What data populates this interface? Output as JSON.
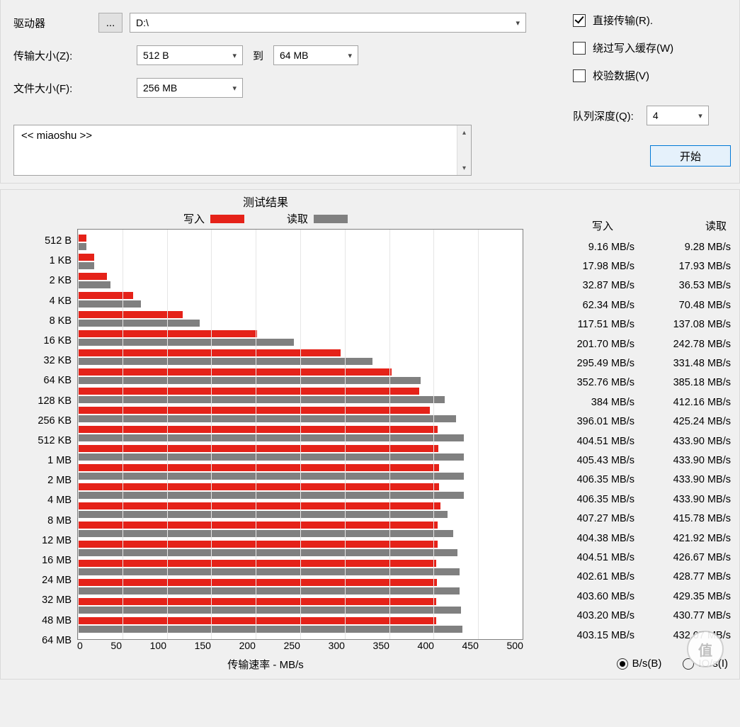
{
  "labels": {
    "drive": "驱动器",
    "transfer_size": "传输大小(Z):",
    "to": "到",
    "file_size": "文件大小(F):",
    "direct_transfer": "直接传输(R).",
    "bypass_cache": "绕过写入缓存(W)",
    "verify": "校验数据(V)",
    "queue_depth": "队列深度(Q):",
    "start_button": "开始",
    "description_placeholder": "<< miaoshu >>",
    "results_title": "测试结果",
    "legend_write": "写入",
    "legend_read": "读取",
    "xlabel": "传输速率 - MB/s",
    "values_write": "写入",
    "values_read": "读取",
    "unit_bps": "B/s(B)",
    "unit_ios": "IO/s(I)",
    "browse_button": "..."
  },
  "values": {
    "drive": "D:\\",
    "transfer_min": "512 B",
    "transfer_max": "64 MB",
    "file_size": "256 MB",
    "queue_depth": "4",
    "direct_transfer_checked": true,
    "bypass_cache_checked": false,
    "verify_checked": false,
    "unit_selected": "bps"
  },
  "chart_data": {
    "type": "bar",
    "title": "测试结果",
    "xlabel": "传输速率 - MB/s",
    "xlim": [
      0,
      500
    ],
    "xticks": [
      0,
      50,
      100,
      150,
      200,
      250,
      300,
      350,
      400,
      450,
      500
    ],
    "categories": [
      "512 B",
      "1 KB",
      "2 KB",
      "4 KB",
      "8 KB",
      "16 KB",
      "32 KB",
      "64 KB",
      "128 KB",
      "256 KB",
      "512 KB",
      "1 MB",
      "2 MB",
      "4 MB",
      "8 MB",
      "12 MB",
      "16 MB",
      "24 MB",
      "32 MB",
      "48 MB",
      "64 MB"
    ],
    "series": [
      {
        "name": "写入",
        "color": "#e52219",
        "values": [
          9.16,
          17.98,
          32.87,
          62.34,
          117.51,
          201.7,
          295.49,
          352.76,
          384,
          396.01,
          404.51,
          405.43,
          406.35,
          406.35,
          407.27,
          404.38,
          404.51,
          402.61,
          403.6,
          403.2,
          403.15
        ]
      },
      {
        "name": "读取",
        "color": "#808080",
        "values": [
          9.28,
          17.93,
          36.53,
          70.48,
          137.08,
          242.78,
          331.48,
          385.18,
          412.16,
          425.24,
          433.9,
          433.9,
          433.9,
          433.9,
          415.78,
          421.92,
          426.67,
          428.77,
          429.35,
          430.77,
          432.07
        ]
      }
    ],
    "unit": "MB/s"
  },
  "result_table": [
    {
      "cat": "512 B",
      "write": "9.16 MB/s",
      "read": "9.28 MB/s"
    },
    {
      "cat": "1 KB",
      "write": "17.98 MB/s",
      "read": "17.93 MB/s"
    },
    {
      "cat": "2 KB",
      "write": "32.87 MB/s",
      "read": "36.53 MB/s"
    },
    {
      "cat": "4 KB",
      "write": "62.34 MB/s",
      "read": "70.48 MB/s"
    },
    {
      "cat": "8 KB",
      "write": "117.51 MB/s",
      "read": "137.08 MB/s"
    },
    {
      "cat": "16 KB",
      "write": "201.70 MB/s",
      "read": "242.78 MB/s"
    },
    {
      "cat": "32 KB",
      "write": "295.49 MB/s",
      "read": "331.48 MB/s"
    },
    {
      "cat": "64 KB",
      "write": "352.76 MB/s",
      "read": "385.18 MB/s"
    },
    {
      "cat": "128 KB",
      "write": "384 MB/s",
      "read": "412.16 MB/s"
    },
    {
      "cat": "256 KB",
      "write": "396.01 MB/s",
      "read": "425.24 MB/s"
    },
    {
      "cat": "512 KB",
      "write": "404.51 MB/s",
      "read": "433.90 MB/s"
    },
    {
      "cat": "1 MB",
      "write": "405.43 MB/s",
      "read": "433.90 MB/s"
    },
    {
      "cat": "2 MB",
      "write": "406.35 MB/s",
      "read": "433.90 MB/s"
    },
    {
      "cat": "4 MB",
      "write": "406.35 MB/s",
      "read": "433.90 MB/s"
    },
    {
      "cat": "8 MB",
      "write": "407.27 MB/s",
      "read": "415.78 MB/s"
    },
    {
      "cat": "12 MB",
      "write": "404.38 MB/s",
      "read": "421.92 MB/s"
    },
    {
      "cat": "16 MB",
      "write": "404.51 MB/s",
      "read": "426.67 MB/s"
    },
    {
      "cat": "24 MB",
      "write": "402.61 MB/s",
      "read": "428.77 MB/s"
    },
    {
      "cat": "32 MB",
      "write": "403.60 MB/s",
      "read": "429.35 MB/s"
    },
    {
      "cat": "48 MB",
      "write": "403.20 MB/s",
      "read": "430.77 MB/s"
    },
    {
      "cat": "64 MB",
      "write": "403.15 MB/s",
      "read": "432.07 MB/s"
    }
  ]
}
